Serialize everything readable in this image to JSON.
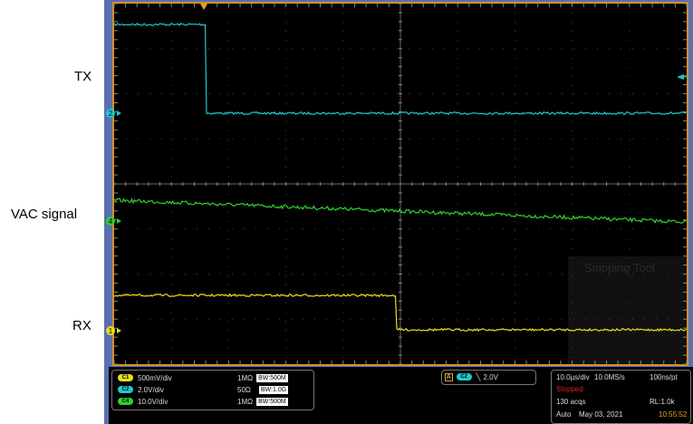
{
  "labels": {
    "tx": "TX",
    "vac": "VAC signal",
    "rx": "RX"
  },
  "colors": {
    "ch1": "#e8e020",
    "ch2": "#20c8d0",
    "ch4": "#30d030",
    "frame": "#d8902a",
    "border": "#5a6fae",
    "stopped": "#e02020",
    "time": "#e8a020"
  },
  "markers": {
    "ch2": "2",
    "ch4": "4",
    "ch1": "1"
  },
  "channels": [
    {
      "chip": "C1",
      "scale": "500mV/div",
      "impedance": "1MΩ",
      "bandwidth": "500M"
    },
    {
      "chip": "C2",
      "scale": "2.0V/div",
      "impedance": "50Ω",
      "bandwidth": "1.0G"
    },
    {
      "chip": "C4",
      "scale": "10.0V/div",
      "impedance": "1MΩ",
      "bandwidth": "500M"
    }
  ],
  "bw_prefix": "BW",
  "trigger": {
    "mode_icon": "A",
    "chip": "C2",
    "slope_icon": "falling-edge-icon",
    "slope": "╲",
    "level": "2.0V"
  },
  "acquisition": {
    "timebase": "10.0µs/div",
    "sample_rate": "10.0MS/s",
    "resolution": "100ns/pt",
    "status": "Stopped",
    "acqs": "130 acqs",
    "record_length": "RL:1.0k",
    "trigger_mode": "Auto",
    "date": "May 03, 2021",
    "time": "10:55:52"
  },
  "watermark": "Snipping Tool"
}
